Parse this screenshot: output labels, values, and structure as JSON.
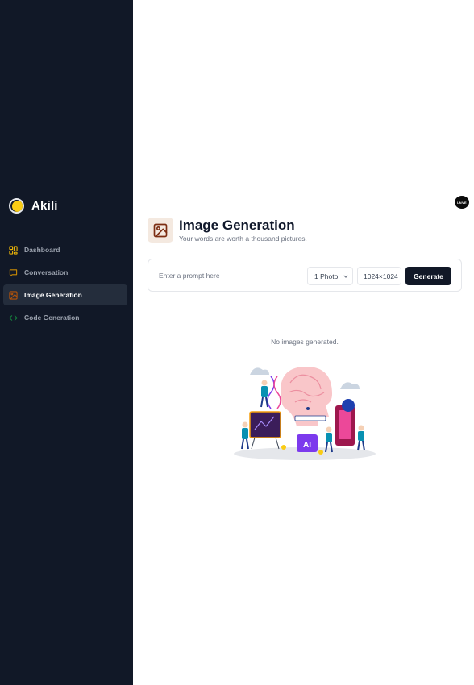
{
  "brand": {
    "name": "Akili"
  },
  "sidebar": {
    "items": [
      {
        "label": "Dashboard",
        "icon": "dashboard-icon",
        "color": "#eab308"
      },
      {
        "label": "Conversation",
        "icon": "message-icon",
        "color": "#ca8a04"
      },
      {
        "label": "Image Generation",
        "icon": "image-icon",
        "color": "#b45309"
      },
      {
        "label": "Code Generation",
        "icon": "code-icon",
        "color": "#15803d"
      }
    ],
    "active": "Image Generation"
  },
  "user": {
    "avatar_text": "LNVE"
  },
  "page": {
    "title": "Image Generation",
    "subtitle": "Your words are worth a thousand pictures."
  },
  "form": {
    "prompt_placeholder": "Enter a prompt here",
    "prompt_value": "",
    "amount_selected": "1 Photo",
    "resolution_selected": "1024×1024",
    "generate_label": "Generate"
  },
  "empty_state": {
    "text": "No images generated."
  },
  "colors": {
    "sidebar_bg": "#111827",
    "active_bg": "#242d3c",
    "accent": "#facc15",
    "button_bg": "#111827"
  }
}
